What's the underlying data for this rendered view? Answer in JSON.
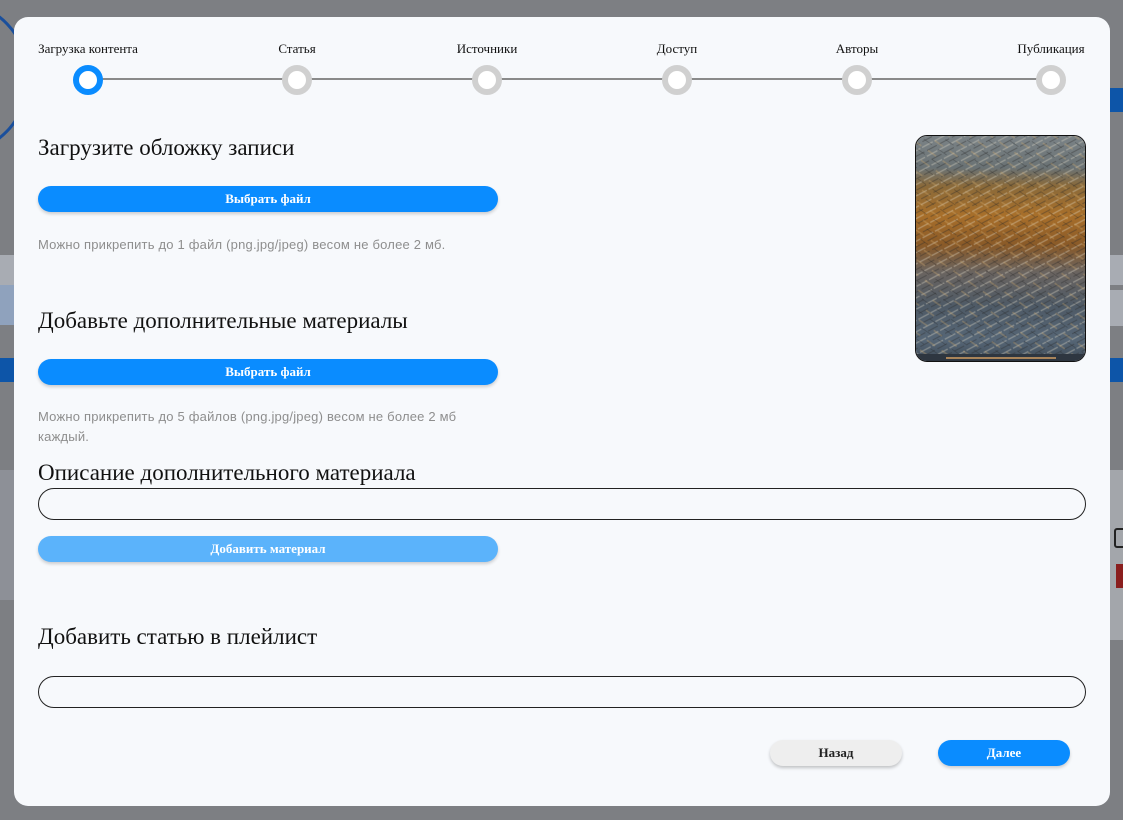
{
  "stepper": {
    "steps": [
      {
        "label": "Загрузка контента",
        "active": true
      },
      {
        "label": "Статья",
        "active": false
      },
      {
        "label": "Источники",
        "active": false
      },
      {
        "label": "Доступ",
        "active": false
      },
      {
        "label": "Авторы",
        "active": false
      },
      {
        "label": "Публикация",
        "active": false
      }
    ]
  },
  "cover_section": {
    "title": "Загрузите обложку записи",
    "button_label": "Выбрать файл",
    "hint": "Можно прикрепить до 1 файл (png.jpg/jpeg) весом не более 2 мб."
  },
  "materials_section": {
    "title": "Добавьте дополнительные материалы",
    "button_label": "Выбрать файл",
    "hint": "Можно прикрепить до 5 файлов (png.jpg/jpeg) весом не более 2 мб каждый."
  },
  "description_section": {
    "title": "Описание дополнительного материала",
    "input_value": "",
    "add_button_label": "Добавить материал"
  },
  "playlist_section": {
    "title": "Добавить статью в плейлист",
    "input_value": ""
  },
  "footer": {
    "back_label": "Назад",
    "next_label": "Далее"
  },
  "colors": {
    "accent": "#0a8cff",
    "accent_disabled": "#5bb3fb",
    "inactive_step": "#d0d0d0"
  }
}
